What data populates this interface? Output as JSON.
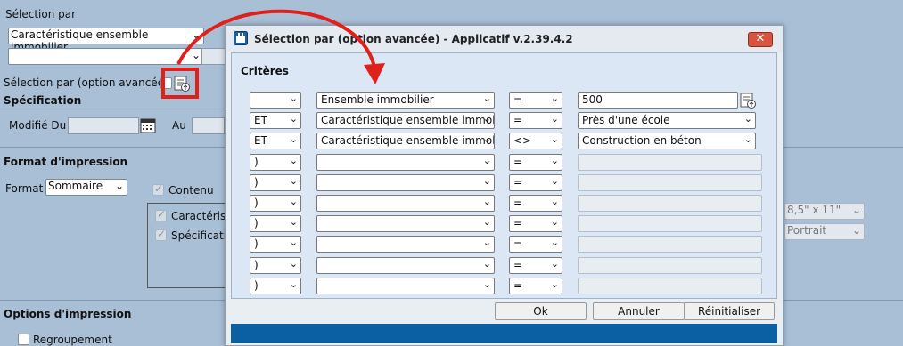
{
  "background": {
    "selection_label": "Sélection par",
    "selection_value": "Caractéristique ensemble immobilier",
    "advanced_label": "Sélection par (option avancée)",
    "specification_heading": "Spécification",
    "modified_label": "Modifié Du",
    "to_label": "Au",
    "print_format_heading": "Format d'impression",
    "format_label": "Format",
    "format_value": "Sommaire",
    "content_label": "Contenu",
    "content_items": [
      "Caractérist",
      "Spécificatio"
    ],
    "paper_size": "8,5\" x 11\"",
    "orientation": "Portrait",
    "print_options_heading": "Options d'impression",
    "grouping_label": "Regroupement"
  },
  "dialog": {
    "title": "Sélection par (option avancée) - Applicatif v.2.39.4.2",
    "section_title": "Critères",
    "rows": [
      {
        "logic": "",
        "field": "Ensemble immobilier",
        "op": "=",
        "value": "500",
        "value_type": "input"
      },
      {
        "logic": "ET",
        "field": "Caractéristique ensemble immob",
        "op": "=",
        "value": "Près d'une école",
        "value_type": "select"
      },
      {
        "logic": "ET",
        "field": "Caractéristique ensemble immob",
        "op": "<>",
        "value": "Construction en béton",
        "value_type": "select"
      },
      {
        "logic": ")",
        "field": "",
        "op": "=",
        "value": "",
        "value_type": "empty"
      },
      {
        "logic": ")",
        "field": "",
        "op": "=",
        "value": "",
        "value_type": "empty"
      },
      {
        "logic": ")",
        "field": "",
        "op": "=",
        "value": "",
        "value_type": "empty"
      },
      {
        "logic": ")",
        "field": "",
        "op": "=",
        "value": "",
        "value_type": "empty"
      },
      {
        "logic": ")",
        "field": "",
        "op": "=",
        "value": "",
        "value_type": "empty"
      },
      {
        "logic": ")",
        "field": "",
        "op": "=",
        "value": "",
        "value_type": "empty"
      },
      {
        "logic": ")",
        "field": "",
        "op": "=",
        "value": "",
        "value_type": "empty"
      }
    ],
    "ok_label": "Ok",
    "cancel_label": "Annuler",
    "reset_label": "Réinitialiser"
  },
  "annotation": {
    "color": "#e0201b",
    "shape": "arrow-and-box"
  },
  "colors": {
    "footer": "#0b5fa3",
    "close": "#d9543f"
  }
}
